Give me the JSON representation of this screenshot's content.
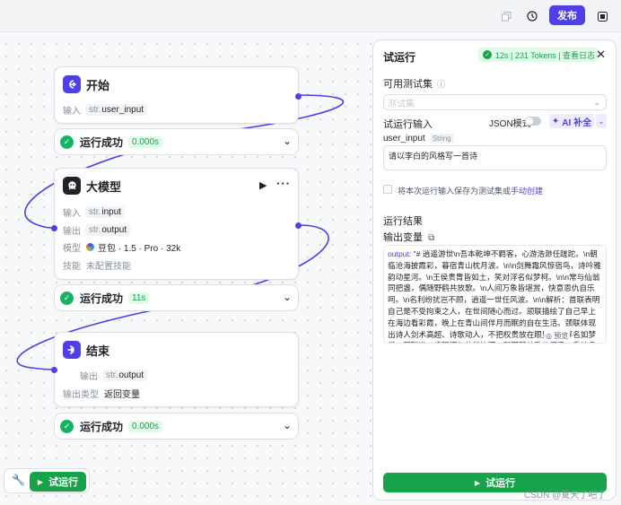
{
  "topbar": {
    "icons": [
      "copy-icon",
      "history-icon",
      "window-icon"
    ],
    "publish_label": "发布"
  },
  "nodes": {
    "start": {
      "title": "开始",
      "icon": "start-icon",
      "input_label": "输入",
      "input_type": "str.",
      "input_name": "user_input",
      "status_text": "运行成功",
      "status_time": "0.000s"
    },
    "llm": {
      "title": "大模型",
      "icon": "model-icon",
      "input_label": "输入",
      "input_type": "str.",
      "input_name": "input",
      "output_label": "输出",
      "output_type": "str.",
      "output_name": "output",
      "model_label": "模型",
      "model_value": "豆包 · 1.5 · Pro · 32k",
      "skill_label": "技能",
      "skill_value": "未配置技能",
      "status_text": "运行成功",
      "status_time": "11s"
    },
    "end": {
      "title": "结束",
      "icon": "end-icon",
      "output_label": "输出",
      "output_type": "str.",
      "output_name": "output",
      "output_kind_label": "输出类型",
      "output_kind_value": "返回变量",
      "status_text": "运行成功",
      "status_time": "0.000s"
    }
  },
  "bottom_toolbar": {
    "run_label": "试运行"
  },
  "panel": {
    "title": "试运行",
    "badge": "12s | 231 Tokens | 查看日志",
    "testset_label": "可用测试集",
    "testset_placeholder": "测试集",
    "input_label": "试运行输入",
    "json_mode_label": "JSON模式",
    "ai_fill_label": "AI 补全",
    "var_name": "user_input",
    "var_type": "String",
    "var_value": "请以李白的风格写一首诗",
    "save_text": "将本次运行输入保存为测试集或",
    "save_link": "手动创建",
    "result_label": "运行结果",
    "output_var_label": "输出变量",
    "output_key": "output",
    "output_value": ": \"# 逍遥游世\\n吾本乾坤不羁客，心游浩渺任蹉跎。\\n朝临沧海披霞彩，暮宿青山枕月波。\\n\\n剑舞霜风惊宿鸟，诗吟雅韵动星河。\\n王侯贵胄皆如土，笑对浮名似梦柯。\\n\\n常与仙翁同把盏，偶随野鹤共放歌。\\n人间万象皆堪赏，快意恩仇自乐呵。\\n名利纷扰岂不顾，逍遥一世任风波。\\n\\n解析：首联表明自己是不受拘束之人，在世间随心而过。颔联描绘了自己早上在海边看彩霞，晚上在青山间伴月而眠的自在生活。颈联体现出诗人剑术高超、诗歌动人，不把权贵放在眼里，视浮名如梦幻。尾联进一步强调与仙翁饮酒、和野鹤放歌的惬意，看淡名利，逍遥于世间的洒脱态度，整体风格模仿李白诗歌的豪放不羁、浪漫自由。\"",
    "preview_label": "预览",
    "run_button": "试运行"
  },
  "watermark": "CSDN @夏天了吧了",
  "colors": {
    "primary": "#4e40e5",
    "success": "#16a34a",
    "border": "#dcdfe6"
  }
}
